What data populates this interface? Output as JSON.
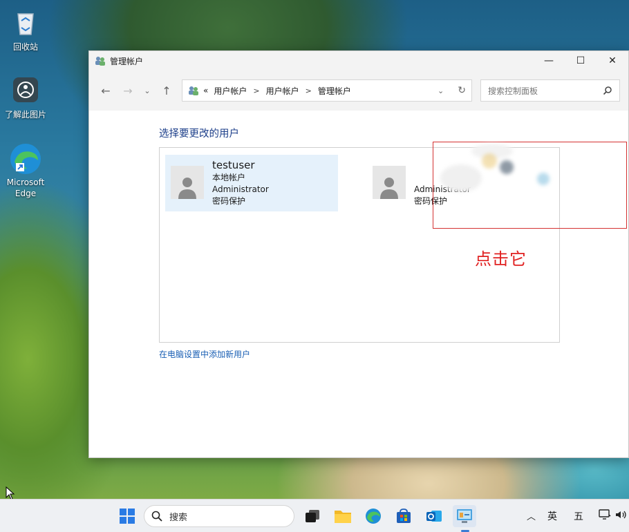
{
  "desktop": {
    "icons": [
      {
        "label": "回收站",
        "icon": "recycle-bin-icon"
      },
      {
        "label": "了解此图片",
        "icon": "info-camera-icon"
      },
      {
        "label": "Microsoft Edge",
        "icon": "edge-icon"
      }
    ]
  },
  "window": {
    "title": "管理帐户",
    "icon": "users-icon",
    "controls": {
      "minimize": "—",
      "maximize": "☐",
      "close": "✕"
    }
  },
  "address": {
    "overflow": "«",
    "crumbs": [
      "用户帐户",
      "用户帐户",
      "管理帐户"
    ],
    "search_placeholder": "搜索控制面板"
  },
  "content": {
    "heading": "选择要更改的用户",
    "users": [
      {
        "name": "testuser",
        "type": "本地帐户",
        "role": "Administrator",
        "status": "密码保护",
        "selected": true
      },
      {
        "name": "",
        "type": "",
        "role": "Administrator",
        "status": "密码保护",
        "selected": false
      }
    ],
    "annotation": "点击它",
    "add_user_link": "在电脑设置中添加新用户"
  },
  "taskbar": {
    "search_label": "搜索",
    "tray": {
      "ime_lang": "英",
      "ime_mode": "五"
    },
    "colors": {
      "accent": "#3b7bd4"
    }
  }
}
